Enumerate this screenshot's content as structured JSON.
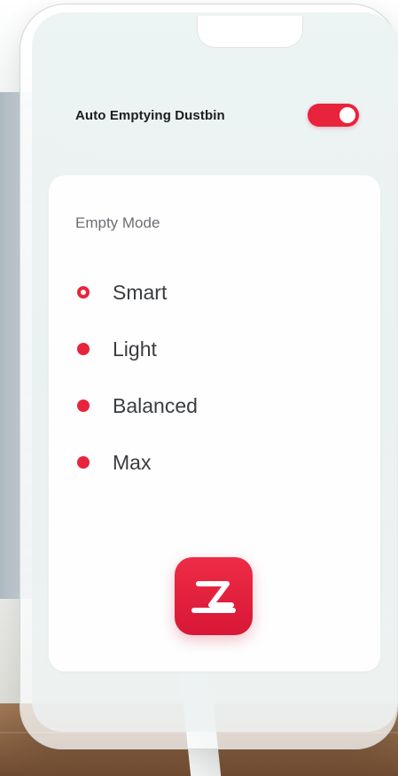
{
  "settings": {
    "auto_empty_label": "Auto Emptying Dustbin",
    "auto_empty_enabled": true
  },
  "empty_mode": {
    "title": "Empty Mode",
    "options": [
      {
        "label": "Smart",
        "selected": true
      },
      {
        "label": "Light",
        "selected": false
      },
      {
        "label": "Balanced",
        "selected": false
      },
      {
        "label": "Max",
        "selected": false
      }
    ]
  },
  "brand": {
    "logo_icon": "roborock-z-logo-icon"
  },
  "colors": {
    "accent": "#e8243c",
    "text_primary": "#1c1c1e",
    "text_secondary": "#6b6f74"
  }
}
